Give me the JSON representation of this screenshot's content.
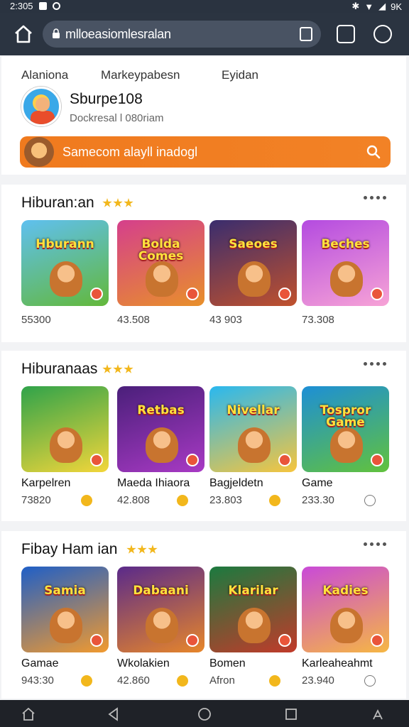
{
  "status": {
    "time": "2:305",
    "battery": "9K"
  },
  "browser": {
    "url": "mlloeasiomlesralan"
  },
  "profile": {
    "tabs": [
      "Alaniona",
      "Markeypabesn",
      "Eyidan"
    ],
    "username": "Sburpe108",
    "subtitle": "Dockresal l 080riam",
    "promo": "Samecom alayll inadogl"
  },
  "sections": [
    {
      "title": "Hiburan:an",
      "games": [
        {
          "art": "Hburann",
          "name": "",
          "value": "55300",
          "colors": [
            "#5fc0f0",
            "#63b83a"
          ]
        },
        {
          "art": "Bolda Comes",
          "name": "",
          "value": "43.508",
          "colors": [
            "#d53f8c",
            "#e8902a"
          ]
        },
        {
          "art": "Saeoes",
          "name": "",
          "value": "43 903",
          "colors": [
            "#3a2d6e",
            "#c0512d"
          ]
        },
        {
          "art": "Beches",
          "name": "",
          "value": "73.308",
          "colors": [
            "#b44be0",
            "#f7a3d6"
          ]
        }
      ]
    },
    {
      "title": "Hiburanaas",
      "games": [
        {
          "art": "",
          "name": "Karpelren",
          "value": "73820",
          "colors": [
            "#2fa34a",
            "#f3d63a"
          ]
        },
        {
          "art": "Retbas",
          "name": "Maeda Ihiaora",
          "value": "42.808",
          "colors": [
            "#4a1f7a",
            "#a83ac4"
          ]
        },
        {
          "art": "Nivellar",
          "name": "Bagjeldetn",
          "value": "23.803",
          "colors": [
            "#29b8f0",
            "#f7c53d"
          ]
        },
        {
          "art": "Tospror Game",
          "name": "Game",
          "value": "233.30",
          "colors": [
            "#1d8fd6",
            "#62c23c"
          ]
        }
      ]
    },
    {
      "title": "Fibay Ham ian",
      "games": [
        {
          "art": "Samia",
          "name": "Gamae",
          "value": "943:30",
          "colors": [
            "#1f5fc7",
            "#f29a2e"
          ]
        },
        {
          "art": "Dabaani",
          "name": "Wkolakien",
          "value": "42.860",
          "colors": [
            "#5a2a8a",
            "#e7862a"
          ]
        },
        {
          "art": "Klarilar",
          "name": "Bomen",
          "value": "Afron",
          "colors": [
            "#1b7a3f",
            "#c23a2a"
          ]
        },
        {
          "art": "Kadies",
          "name": "Karleaheahmt",
          "value": "23.940",
          "colors": [
            "#c94ad8",
            "#f6b743"
          ]
        }
      ]
    }
  ]
}
